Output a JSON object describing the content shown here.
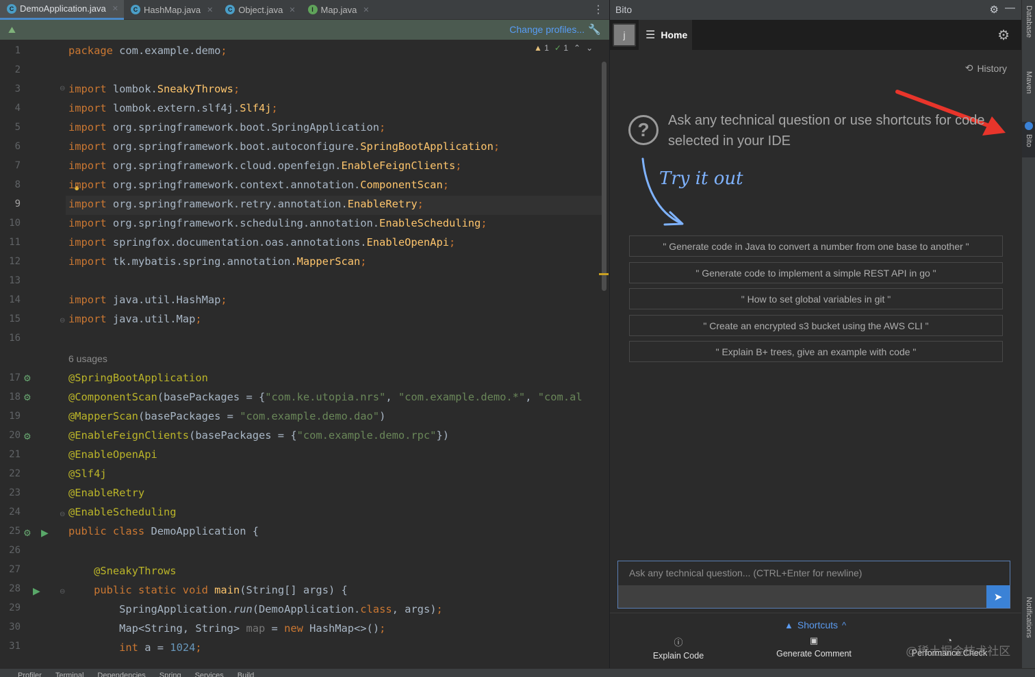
{
  "editor": {
    "tabs": [
      {
        "label": "DemoApplication.java",
        "icon": "c",
        "active": true
      },
      {
        "label": "HashMap.java",
        "icon": "c",
        "active": false
      },
      {
        "label": "Object.java",
        "icon": "c",
        "active": false
      },
      {
        "label": "Map.java",
        "icon": "i",
        "active": false
      }
    ],
    "change_profiles": "Change profiles...",
    "inspections": {
      "warnings": "1",
      "checks": "1"
    },
    "usages": "6 usages",
    "line_numbers": [
      "1",
      "2",
      "3",
      "4",
      "5",
      "6",
      "7",
      "8",
      "9",
      "10",
      "11",
      "12",
      "13",
      "14",
      "15",
      "16",
      "17",
      "18",
      "19",
      "20",
      "21",
      "22",
      "23",
      "24",
      "25",
      "26",
      "27",
      "28",
      "29",
      "30",
      "31"
    ]
  },
  "bito": {
    "title": "Bito",
    "avatar_letter": "j",
    "home_label": "Home",
    "history_label": "History",
    "intro_text": "Ask any technical question or use shortcuts for code selected in your IDE",
    "try_it_out": "Try it out",
    "suggestions": [
      "\" Generate code in Java to convert a number from one base to another \"",
      "\" Generate code to implement a simple REST API in go \"",
      "\" How to set global variables in git \"",
      "\" Create an encrypted s3 bucket using the AWS CLI \"",
      "\" Explain B+ trees, give an example with code \""
    ],
    "input_placeholder": "Ask any technical question... (CTRL+Enter for newline)",
    "shortcuts_label": "Shortcuts",
    "actions": [
      "Explain Code",
      "Generate Comment",
      "Performance Check"
    ],
    "watermark": "@稀土掘金技术社区"
  },
  "toolstrip": {
    "database": "Database",
    "maven": "Maven",
    "bito": "Bito",
    "notifications": "Notifications"
  },
  "statusbar": [
    "Profiler",
    "Terminal",
    "Dependencies",
    "Spring",
    "Services",
    "Build"
  ],
  "colors": {
    "keyword": "#cc7832",
    "class": "#ffc66d",
    "string": "#6a8759",
    "annotation": "#bbb529",
    "accent": "#3b82d6"
  }
}
